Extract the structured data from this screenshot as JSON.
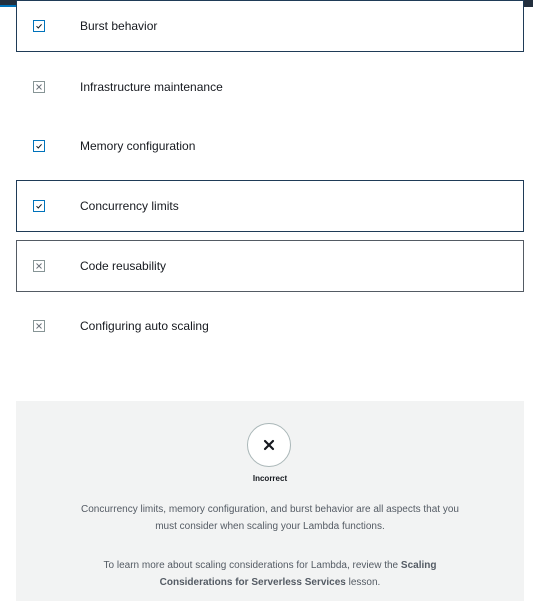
{
  "options": [
    {
      "label": "Burst behavior",
      "checked": true
    },
    {
      "label": "Infrastructure maintenance",
      "checked": false
    },
    {
      "label": "Memory configuration",
      "checked": true
    },
    {
      "label": "Concurrency limits",
      "checked": true
    },
    {
      "label": "Code reusability",
      "checked": false
    },
    {
      "label": "Configuring auto scaling",
      "checked": false
    }
  ],
  "feedback": {
    "result": "Incorrect",
    "explanation": "Concurrency limits, memory configuration, and burst behavior are all aspects that you must consider when scaling your Lambda functions.",
    "learn_more_prefix": "To learn more about scaling considerations for Lambda, review the",
    "learn_more_link": "Scaling Considerations for Serverless Services",
    "learn_more_suffix": "lesson."
  },
  "icons": {
    "checked": "check-icon",
    "unchecked": "x-icon",
    "result": "close-icon"
  },
  "colors": {
    "accent": "#0073bb",
    "header": "#232f3e",
    "feedback_bg": "#f2f3f3"
  }
}
